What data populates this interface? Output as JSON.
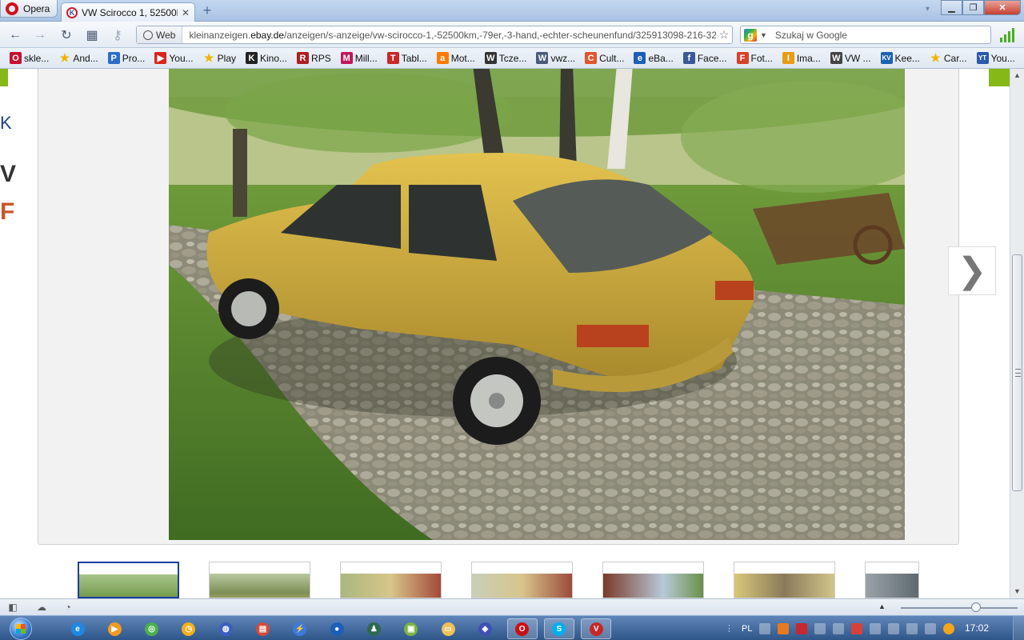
{
  "browser": {
    "menu_label": "Opera",
    "tab_title": "VW Scirocco 1, 52500k...",
    "tab_favicon_letter": "K",
    "address_mode": "Web",
    "url_prefix": "kleinanzeigen.",
    "url_domain": "ebay.de",
    "url_path": "/anzeigen/s-anzeige/vw-scirocco-1,-52500km,-79er,-3-hand,-echter-scheunenfund/325913098-216-32",
    "search_placeholder": "Szukaj w Google"
  },
  "bookmarks": [
    {
      "label": "skle...",
      "icon": "opera-icon",
      "color": "#c8102e",
      "glyph": "O"
    },
    {
      "label": "And...",
      "icon": "star-icon",
      "color": "#f0b400",
      "glyph": "★"
    },
    {
      "label": "Pro...",
      "icon": "p-icon",
      "color": "#2a6dc9",
      "glyph": "P"
    },
    {
      "label": "You...",
      "icon": "youtube-icon",
      "color": "#d9251d",
      "glyph": "▶"
    },
    {
      "label": "Play",
      "icon": "star-icon",
      "color": "#f0b400",
      "glyph": "★"
    },
    {
      "label": "Kino...",
      "icon": "kino-icon",
      "color": "#222222",
      "glyph": "K"
    },
    {
      "label": "RPS",
      "icon": "rps-icon",
      "color": "#b01e23",
      "glyph": "R"
    },
    {
      "label": "Mill...",
      "icon": "m-icon",
      "color": "#c2185b",
      "glyph": "M"
    },
    {
      "label": "Tabl...",
      "icon": "tabl-icon",
      "color": "#c62828",
      "glyph": "T"
    },
    {
      "label": "Mot...",
      "icon": "a-icon",
      "color": "#ff7a00",
      "glyph": "a"
    },
    {
      "label": "Tcze...",
      "icon": "vw-icon",
      "color": "#333333",
      "glyph": "W"
    },
    {
      "label": "vwz...",
      "icon": "vw-icon",
      "color": "#4a5a7a",
      "glyph": "W"
    },
    {
      "label": "Cult...",
      "icon": "cult-icon",
      "color": "#e0562b",
      "glyph": "C"
    },
    {
      "label": "eBa...",
      "icon": "ebay-icon",
      "color": "#1b5fb8",
      "glyph": "e"
    },
    {
      "label": "Face...",
      "icon": "facebook-icon",
      "color": "#3b5998",
      "glyph": "f"
    },
    {
      "label": "Fot...",
      "icon": "photo-icon",
      "color": "#d8402a",
      "glyph": "F"
    },
    {
      "label": "Ima...",
      "icon": "image-icon",
      "color": "#e89c14",
      "glyph": "I"
    },
    {
      "label": "VW ...",
      "icon": "vw-icon",
      "color": "#444444",
      "glyph": "W"
    },
    {
      "label": "Kee...",
      "icon": "kv-icon",
      "color": "#1e62b0",
      "glyph": "KV"
    },
    {
      "label": "Car...",
      "icon": "star-icon",
      "color": "#f0b400",
      "glyph": "★"
    },
    {
      "label": "You...",
      "icon": "yt-icon",
      "color": "#2a5aa8",
      "glyph": "YT"
    }
  ],
  "page": {
    "left_peek_1": "K",
    "left_peek_2": "V",
    "left_peek_3": "F",
    "next_icon": "chevron-right-icon",
    "thumbnail_count": 7
  },
  "taskbar": {
    "language": "PL",
    "clock": "17:02",
    "apps": [
      "ie-icon",
      "media-player-icon",
      "chrome-icon",
      "clock-app-icon",
      "globe-icon",
      "winrar-icon",
      "lightning-icon",
      "ball-icon",
      "agent-icon",
      "game-icon",
      "folder-icon",
      "shield-app-icon",
      "opera-icon",
      "skype-icon",
      "antivirus-icon"
    ]
  },
  "colors": {
    "accent_green": "#86b817",
    "selection_blue": "#1c3ea0",
    "opera_red": "#d0101b"
  }
}
